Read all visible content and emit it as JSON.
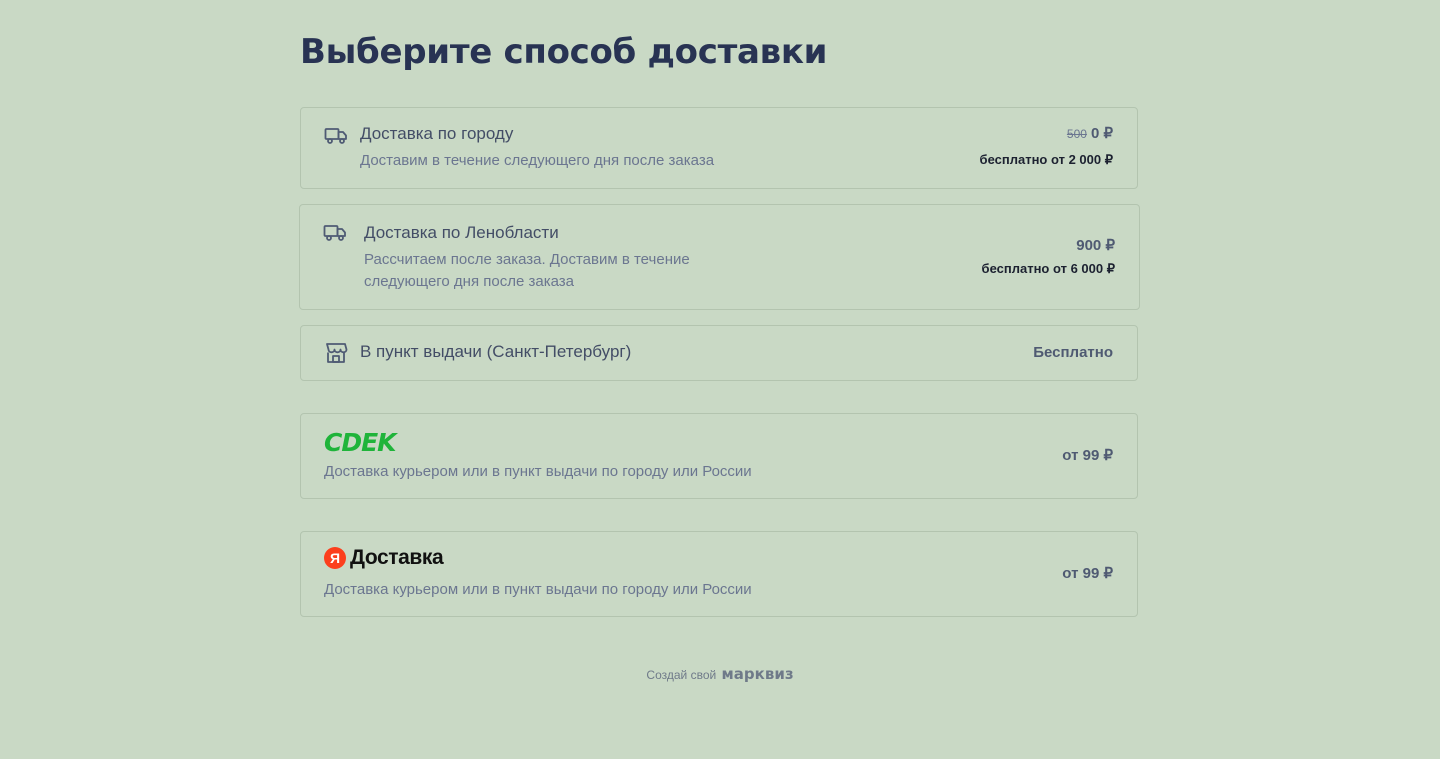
{
  "page": {
    "title": "Выберите способ доставки"
  },
  "options": [
    {
      "id": "city",
      "icon": "truck-icon",
      "title": "Доставка по городу",
      "subtitle": "Доставим в течение следующего дня после заказа",
      "old_price": "500",
      "price": "0 ₽",
      "free_note": "бесплатно от 2 000  ₽"
    },
    {
      "id": "region",
      "icon": "truck-icon",
      "title": "Доставка по Ленобласти",
      "subtitle_line1": "Рассчитаем после заказа. Доставим в течение",
      "subtitle_line2": "следующего дня после заказа",
      "price": "900 ₽",
      "free_note": "бесплатно от 6 000  ₽"
    },
    {
      "id": "pickup",
      "icon": "store-icon",
      "title": "В пункт выдачи (Санкт-Петербург)",
      "price": "Бесплатно"
    },
    {
      "id": "cdek",
      "logo_text": "CDEK",
      "brand_color": "#1fb43a",
      "subtitle": "Доставка курьером или в пункт выдачи по городу или России",
      "price": "от 99 ₽"
    },
    {
      "id": "yandex",
      "logo_letter": "Я",
      "logo_text": "Доставка",
      "brand_color": "#fc3f1d",
      "subtitle": "Доставка курьером или в пункт выдачи по городу или России",
      "price": "от 99 ₽"
    }
  ],
  "footer": {
    "prefix": "Создай свой",
    "brand": "марквиз"
  },
  "colors": {
    "background": "#c9d9c5",
    "title": "#283353",
    "border": "#b3c4af"
  }
}
